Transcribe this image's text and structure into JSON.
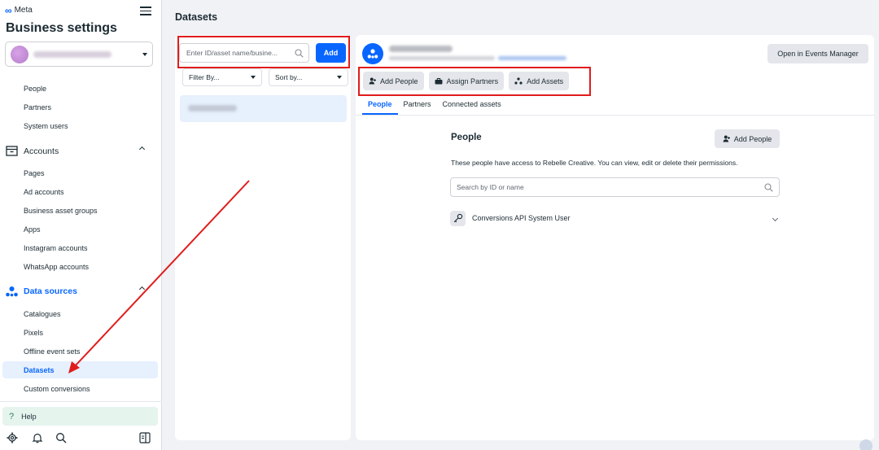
{
  "brand": {
    "logo_text": "Meta",
    "accent": "#0866ff",
    "annotation_color": "#e01c1c"
  },
  "sidebar": {
    "title": "Business settings",
    "users": [
      "People",
      "Partners",
      "System users"
    ],
    "accounts": {
      "label": "Accounts",
      "items": [
        "Pages",
        "Ad accounts",
        "Business asset groups",
        "Apps",
        "Instagram accounts",
        "WhatsApp accounts"
      ]
    },
    "data_sources": {
      "label": "Data sources",
      "items": [
        "Catalogues",
        "Pixels",
        "Offline event sets",
        "Datasets",
        "Custom conversions"
      ]
    },
    "active_item": "Datasets",
    "help_label": "Help"
  },
  "main": {
    "page_title": "Datasets",
    "search": {
      "placeholder": "Enter ID/asset name/busine...",
      "add_label": "Add"
    },
    "filter_label": "Filter By...",
    "sort_label": "Sort by..."
  },
  "detail": {
    "open_events_manager": "Open in Events Manager",
    "actions": [
      "Add People",
      "Assign Partners",
      "Add Assets"
    ],
    "tabs": [
      "People",
      "Partners",
      "Connected assets"
    ],
    "active_tab": "People",
    "section_title": "People",
    "add_people_label": "Add People",
    "description": "These people have access to Rebelle Creative. You can view, edit or delete their permissions.",
    "people_search_placeholder": "Search by ID or name",
    "people": [
      "Conversions API System User"
    ]
  }
}
